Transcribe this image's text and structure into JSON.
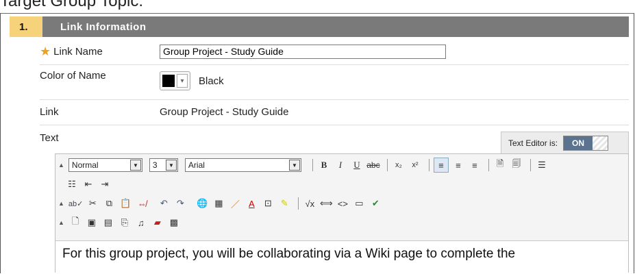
{
  "header_text": "Target Group Topic:",
  "step": {
    "number": "1.",
    "title": "Link Information"
  },
  "fields": {
    "link_name": {
      "label": "Link Name",
      "value": "Group Project - Study Guide"
    },
    "color_of_name": {
      "label": "Color of Name",
      "value": "Black",
      "swatch_color": "#000000"
    },
    "link": {
      "label": "Link",
      "value": "Group Project - Study Guide"
    },
    "text": {
      "label": "Text"
    }
  },
  "text_editor": {
    "toggle_label": "Text Editor is:",
    "toggle_state": "ON",
    "format_select": "Normal",
    "size_select": "3",
    "font_select": "Arial",
    "content": "For this group project, you will be collaborating via a Wiki page to complete the"
  },
  "colors": {
    "step_number_bg": "#f6d37a",
    "step_title_bg": "#7a7a7a",
    "toggle_on_bg": "#5c7390",
    "required_star": "#f0a020"
  }
}
